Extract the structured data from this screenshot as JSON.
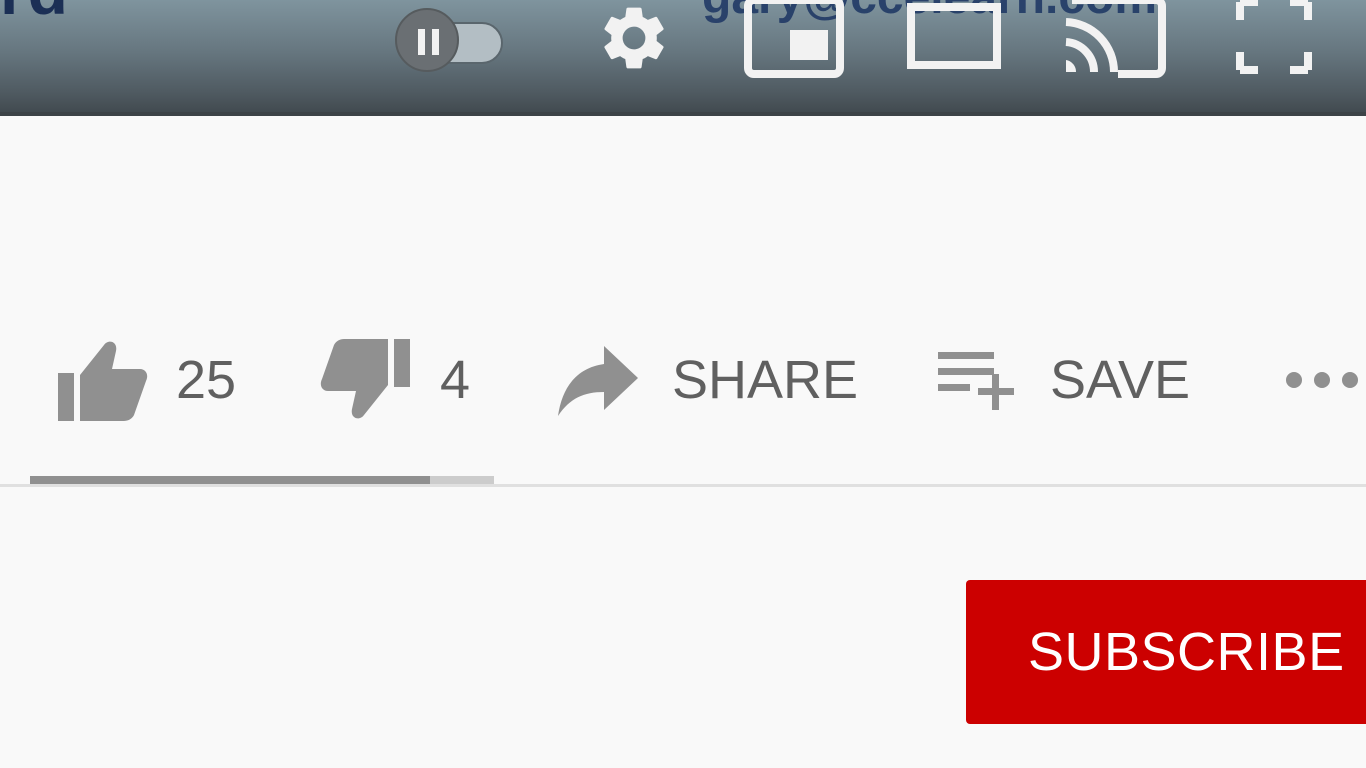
{
  "player": {
    "video_overlay_text_left": "rd",
    "video_overlay_text_right": "gary@ccelearn.com",
    "autoplay": {
      "state": "on",
      "icon": "pause-icon"
    },
    "controls": [
      {
        "name": "settings",
        "icon": "gear-icon"
      },
      {
        "name": "miniplayer",
        "icon": "miniplayer-icon"
      },
      {
        "name": "theater",
        "icon": "theater-mode-icon"
      },
      {
        "name": "cast",
        "icon": "cast-icon"
      },
      {
        "name": "fullscreen",
        "icon": "fullscreen-icon"
      }
    ]
  },
  "actions": {
    "like": {
      "count": "25",
      "icon": "thumbs-up-icon"
    },
    "dislike": {
      "count": "4",
      "icon": "thumbs-down-icon"
    },
    "share": {
      "label": "SHARE",
      "icon": "share-arrow-icon"
    },
    "save": {
      "label": "SAVE",
      "icon": "playlist-add-icon"
    },
    "more": {
      "icon": "more-horizontal-icon"
    }
  },
  "sentiment": {
    "like_fraction": 0.862
  },
  "subscribe": {
    "label": "SUBSCRIBE"
  },
  "colors": {
    "subscribe_bg": "#cc0000",
    "icon_gray": "#909090",
    "text_gray": "#606060",
    "page_bg": "#f9f9f9"
  }
}
